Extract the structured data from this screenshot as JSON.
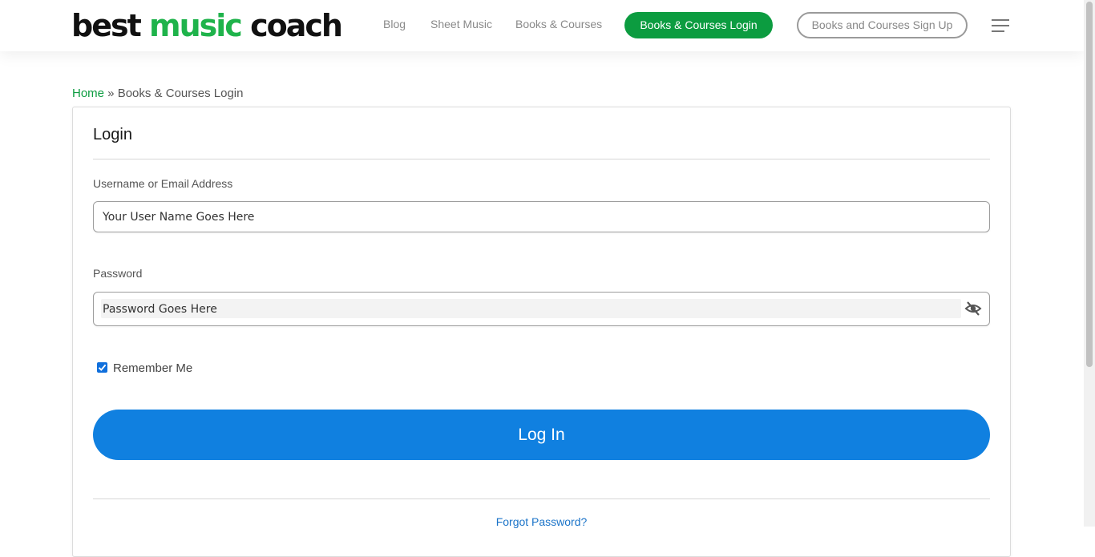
{
  "header": {
    "logo": {
      "word1": "best",
      "word2": "music",
      "word3": "coach"
    },
    "nav": {
      "blog": "Blog",
      "sheet_music": "Sheet Music",
      "books_courses": "Books & Courses",
      "login": "Books & Courses Login",
      "signup": "Books and Courses Sign Up"
    },
    "menu_icon": "hamburger-menu-icon"
  },
  "breadcrumb": {
    "home": "Home",
    "separator": " » ",
    "current": "Books & Courses Login"
  },
  "login_form": {
    "title": "Login",
    "username_label": "Username or Email Address",
    "username_value": "Your User Name Goes Here",
    "password_label": "Password",
    "password_value": "Password Goes Here",
    "password_toggle_icon": "eye-slash-icon",
    "remember_me_label": "Remember Me",
    "remember_me_checked": true,
    "submit_label": "Log In",
    "forgot_password": "Forgot Password?"
  },
  "colors": {
    "brand_green": "#0c9c40",
    "logo_green": "#1fb34b",
    "primary_blue": "#1080e0",
    "link_blue": "#1a73c8"
  }
}
